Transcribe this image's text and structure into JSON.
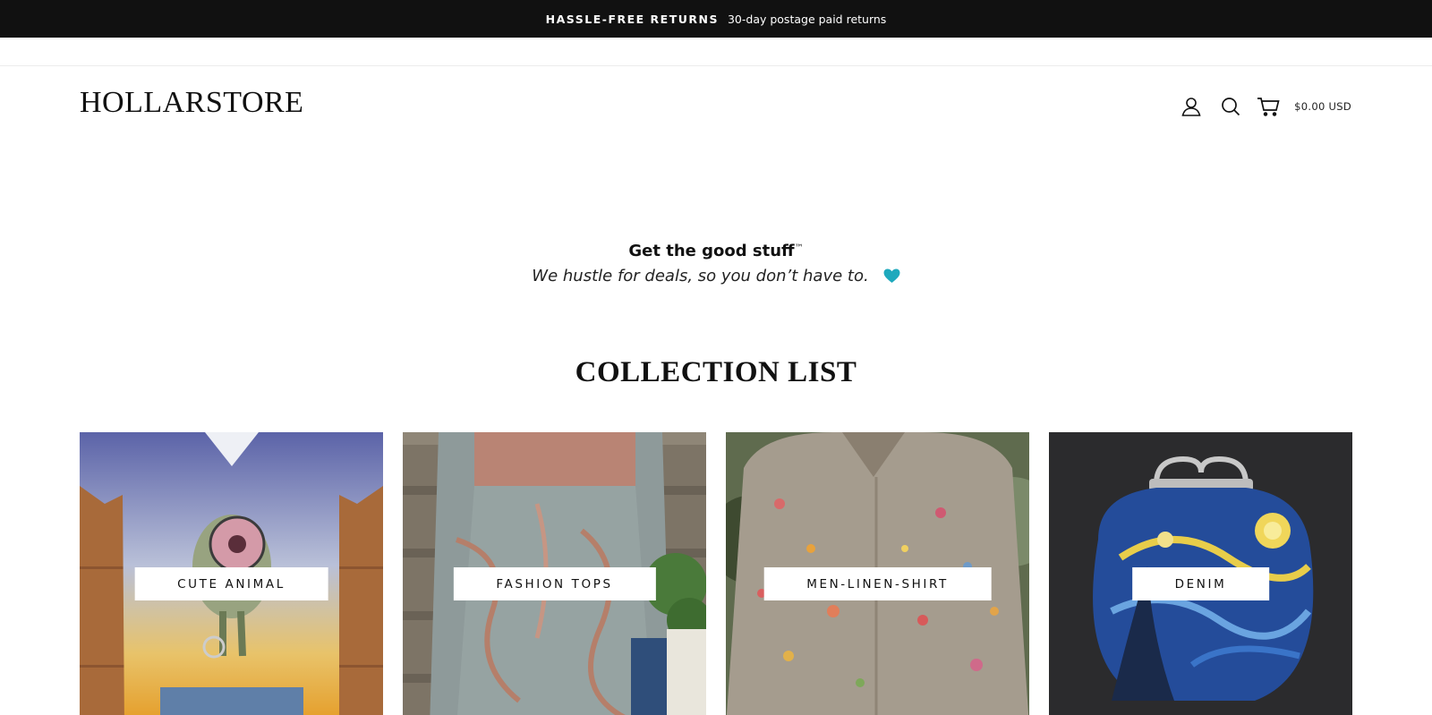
{
  "announcement": {
    "bold": "HASSLE-FREE RETURNS",
    "text": "30-day postage paid returns"
  },
  "header": {
    "logo": "HOLLARSTORE",
    "icons": [
      "account-icon",
      "search-icon",
      "cart-icon"
    ],
    "cart_total": "$0.00 USD"
  },
  "tagline": {
    "line1": "Get the good stuff",
    "line1_mark": "™",
    "line2": "We hustle for deals, so you don’t have to.",
    "heart_icon": "heart-icon",
    "heart_color": "#1ea9bd"
  },
  "collections": {
    "title": "COLLECTION LIST",
    "items": [
      {
        "label": "CUTE ANIMAL"
      },
      {
        "label": "FASHION TOPS"
      },
      {
        "label": "MEN-LINEN-SHIRT"
      },
      {
        "label": "DENIM"
      }
    ]
  }
}
